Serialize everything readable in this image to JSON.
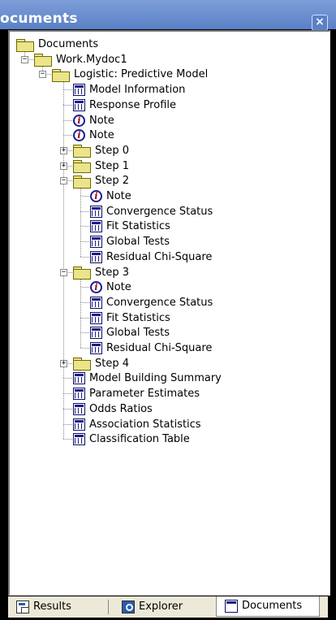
{
  "window": {
    "title": "ocuments",
    "close_label": "×"
  },
  "tree": [
    {
      "id": "documents",
      "label": "Documents",
      "icon": "folder-icon",
      "level": 0,
      "expander": ""
    },
    {
      "id": "work-mydoc1",
      "label": "Work.Mydoc1",
      "icon": "folder-icon",
      "level": 1,
      "expander": "−"
    },
    {
      "id": "logistic",
      "label": "Logistic:  Predictive Model",
      "icon": "folder-icon",
      "level": 2,
      "expander": "−"
    },
    {
      "id": "model-information",
      "label": "Model Information",
      "icon": "table-icon",
      "level": 3,
      "expander": ""
    },
    {
      "id": "response-profile",
      "label": "Response Profile",
      "icon": "table-icon",
      "level": 3,
      "expander": ""
    },
    {
      "id": "note-1",
      "label": "Note",
      "icon": "note-icon",
      "level": 3,
      "expander": ""
    },
    {
      "id": "note-2",
      "label": "Note",
      "icon": "note-icon",
      "level": 3,
      "expander": ""
    },
    {
      "id": "step-0",
      "label": "Step 0",
      "icon": "folder-icon",
      "level": 3,
      "expander": "+"
    },
    {
      "id": "step-1",
      "label": "Step 1",
      "icon": "folder-icon",
      "level": 3,
      "expander": "+"
    },
    {
      "id": "step-2",
      "label": "Step 2",
      "icon": "folder-icon",
      "level": 3,
      "expander": "−"
    },
    {
      "id": "step2-note",
      "label": "Note",
      "icon": "note-icon",
      "level": 4,
      "expander": ""
    },
    {
      "id": "step2-convergence",
      "label": "Convergence Status",
      "icon": "table-icon",
      "level": 4,
      "expander": ""
    },
    {
      "id": "step2-fit",
      "label": "Fit Statistics",
      "icon": "table-icon",
      "level": 4,
      "expander": ""
    },
    {
      "id": "step2-global",
      "label": "Global Tests",
      "icon": "table-icon",
      "level": 4,
      "expander": ""
    },
    {
      "id": "step2-residual",
      "label": "Residual Chi-Square",
      "icon": "table-icon",
      "level": 4,
      "expander": ""
    },
    {
      "id": "step-3",
      "label": "Step 3",
      "icon": "folder-icon",
      "level": 3,
      "expander": "−"
    },
    {
      "id": "step3-note",
      "label": "Note",
      "icon": "note-icon",
      "level": 4,
      "expander": ""
    },
    {
      "id": "step3-convergence",
      "label": "Convergence Status",
      "icon": "table-icon",
      "level": 4,
      "expander": ""
    },
    {
      "id": "step3-fit",
      "label": "Fit Statistics",
      "icon": "table-icon",
      "level": 4,
      "expander": ""
    },
    {
      "id": "step3-global",
      "label": "Global Tests",
      "icon": "table-icon",
      "level": 4,
      "expander": ""
    },
    {
      "id": "step3-residual",
      "label": "Residual Chi-Square",
      "icon": "table-icon",
      "level": 4,
      "expander": ""
    },
    {
      "id": "step-4",
      "label": "Step 4",
      "icon": "folder-icon",
      "level": 3,
      "expander": "+"
    },
    {
      "id": "model-building-summary",
      "label": "Model Building Summary",
      "icon": "table-icon",
      "level": 3,
      "expander": ""
    },
    {
      "id": "parameter-estimates",
      "label": "Parameter Estimates",
      "icon": "table-icon",
      "level": 3,
      "expander": ""
    },
    {
      "id": "odds-ratios",
      "label": "Odds Ratios",
      "icon": "table-icon",
      "level": 3,
      "expander": ""
    },
    {
      "id": "association-statistics",
      "label": "Association Statistics",
      "icon": "table-icon",
      "level": 3,
      "expander": ""
    },
    {
      "id": "classification-table",
      "label": "Classification Table",
      "icon": "table-icon",
      "level": 3,
      "expander": ""
    }
  ],
  "tabs": [
    {
      "label": "Results",
      "icon": "results-icon",
      "active": false
    },
    {
      "label": "Explorer",
      "icon": "explorer-icon",
      "active": false
    },
    {
      "label": "Documents",
      "icon": "documents-icon",
      "active": true
    }
  ]
}
